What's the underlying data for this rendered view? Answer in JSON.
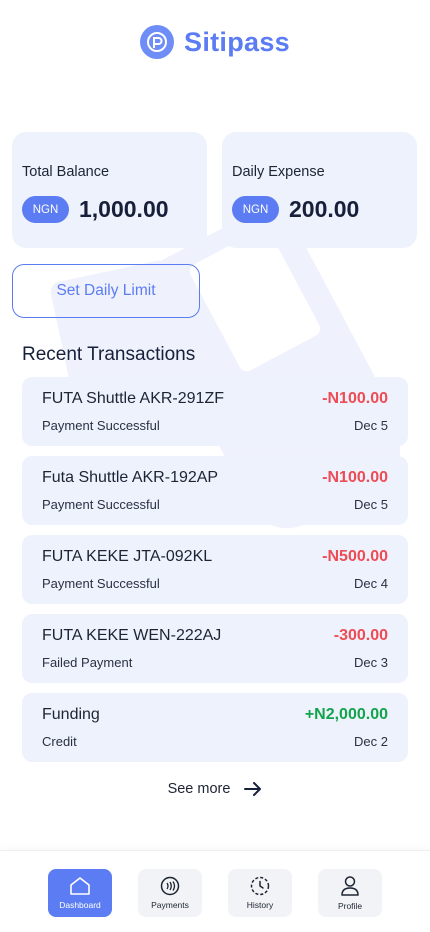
{
  "app": {
    "brand": "Sitipass"
  },
  "balance_card": {
    "title": "Total Balance",
    "currency": "NGN",
    "amount": "1,000.00"
  },
  "expense_card": {
    "title": "Daily Expense",
    "currency": "NGN",
    "amount": "200.00"
  },
  "actions": {
    "set_limit_label": "Set Daily Limit"
  },
  "transactions": {
    "title": "Recent Transactions",
    "items": [
      {
        "name": "FUTA Shuttle AKR-291ZF",
        "amount": "-N100.00",
        "status": "Payment Successful",
        "date": "Dec 5",
        "amount_color": "#ee4c55"
      },
      {
        "name": "Futa Shuttle AKR-192AP",
        "amount": "-N100.00",
        "status": "Payment Successful",
        "date": "Dec 5",
        "amount_color": "#ee4c55"
      },
      {
        "name": "FUTA KEKE JTA-092KL",
        "amount": "-N500.00",
        "status": "Payment Successful",
        "date": "Dec 4",
        "amount_color": "#ee4c55"
      },
      {
        "name": "FUTA KEKE WEN-222AJ",
        "amount": "-300.00",
        "status": "Failed Payment",
        "date": "Dec 3",
        "amount_color": "#ee4c55"
      },
      {
        "name": "Funding",
        "amount": "+N2,000.00",
        "status": "Credit",
        "date": "Dec 2",
        "amount_color": "#12a44a"
      }
    ],
    "see_more_label": "See more"
  },
  "nav": {
    "items": [
      {
        "label": "Dashboard",
        "icon": "home-icon",
        "active": true
      },
      {
        "label": "Payments",
        "icon": "contactless-icon",
        "active": false
      },
      {
        "label": "History",
        "icon": "history-icon",
        "active": false
      },
      {
        "label": "Profile",
        "icon": "user-icon",
        "active": false
      }
    ]
  },
  "colors": {
    "accent": "#5b7cf2",
    "card_bg": "#eef2fd",
    "debit": "#ee4c55",
    "credit": "#12a44a"
  }
}
